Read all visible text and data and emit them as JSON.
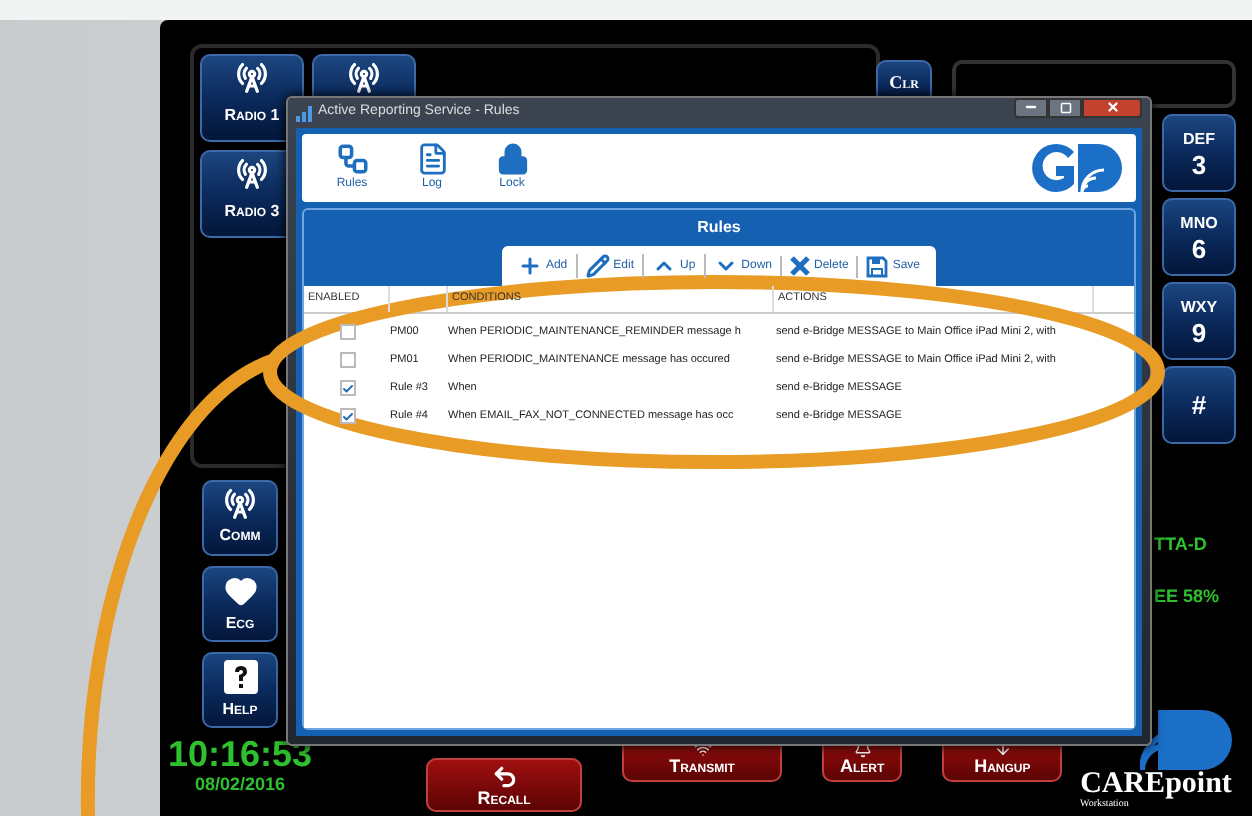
{
  "app": {
    "radio_buttons": [
      {
        "kind": "radio",
        "label": "Radio 1"
      },
      {
        "kind": "radio"
      },
      {
        "kind": "radio",
        "label": "Radio 3"
      }
    ],
    "clear_button": "Clr",
    "keypad": [
      {
        "letters": "DEF",
        "digit": "3"
      },
      {
        "letters": "MNO",
        "digit": "6"
      },
      {
        "letters": "WXY",
        "digit": "9"
      },
      {
        "digit": "#"
      }
    ],
    "side_buttons": [
      {
        "kind": "comm",
        "label": "Comm"
      },
      {
        "kind": "ecg",
        "label": "Ecg"
      },
      {
        "kind": "help",
        "label": "Help"
      }
    ],
    "time": "10:16:53",
    "date": "08/02/2016",
    "bottom_buttons": [
      {
        "kind": "recall",
        "label": "Recall"
      },
      {
        "kind": "transmit",
        "label": "Transmit"
      },
      {
        "kind": "alert",
        "label": "Alert"
      },
      {
        "kind": "hangup",
        "label": "Hangup"
      }
    ],
    "status_lines": [
      "TTA-D",
      "EE 58%"
    ],
    "logo": {
      "name": "CAREpoint",
      "subtitle": "Workstation"
    }
  },
  "dialog": {
    "title": "Active Reporting Service - Rules",
    "nav": [
      {
        "kind": "rules",
        "label": "Rules"
      },
      {
        "kind": "log",
        "label": "Log"
      },
      {
        "kind": "lock",
        "label": "Lock"
      }
    ],
    "panel_title": "Rules",
    "toolbar": [
      {
        "kind": "add",
        "label": "Add"
      },
      {
        "kind": "edit",
        "label": "Edit"
      },
      {
        "kind": "up",
        "label": "Up"
      },
      {
        "kind": "down",
        "label": "Down"
      },
      {
        "kind": "delete",
        "label": "Delete"
      },
      {
        "kind": "save",
        "label": "Save"
      }
    ],
    "columns": [
      "ENABLED",
      "",
      "CONDITIONS",
      "ACTIONS"
    ],
    "rows": [
      {
        "checked": false,
        "name": "PM00",
        "condition": "When PERIODIC_MAINTENANCE_REMINDER message h",
        "action": "send e-Bridge MESSAGE to Main Office iPad Mini 2, with"
      },
      {
        "checked": false,
        "name": "PM01",
        "condition": "When PERIODIC_MAINTENANCE message has occured",
        "action": "send e-Bridge MESSAGE to Main Office iPad Mini 2, with"
      },
      {
        "checked": true,
        "name": "Rule #3",
        "condition": "When",
        "action": "send e-Bridge MESSAGE"
      },
      {
        "checked": true,
        "name": "Rule #4",
        "condition": "When EMAIL_FAX_NOT_CONNECTED message has occ",
        "action": "send e-Bridge MESSAGE"
      }
    ]
  }
}
